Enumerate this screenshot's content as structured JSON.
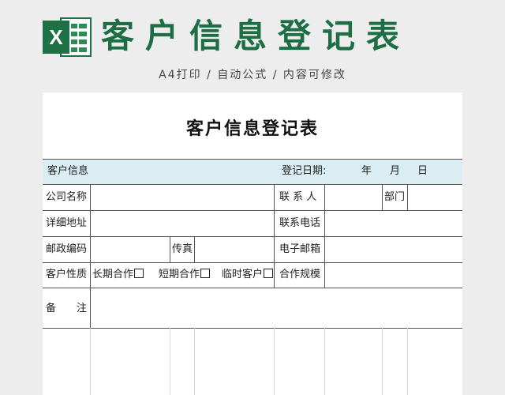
{
  "banner": {
    "logo_letter": "X",
    "title": "客户信息登记表",
    "subtitle": "A4打印 / 自动公式 / 内容可修改"
  },
  "doc": {
    "title": "客户信息登记表",
    "header": {
      "left": "客户信息",
      "date_label": "登记日期:",
      "year": "年",
      "month": "月",
      "day": "日"
    },
    "rows": {
      "company": "公司名称",
      "contact": "联 系 人",
      "dept": "部门",
      "address": "详细地址",
      "phone": "联系电话",
      "postcode": "邮政编码",
      "fax": "传真",
      "email": "电子邮箱",
      "nature": "客户性质",
      "opt_long": "长期合作",
      "opt_short": "短期合作",
      "opt_temp": "临时客户",
      "scale": "合作规模",
      "remark": "备　　注"
    }
  },
  "colors": {
    "brand_green": "#1e6e45",
    "header_band": "#d9edf3"
  }
}
